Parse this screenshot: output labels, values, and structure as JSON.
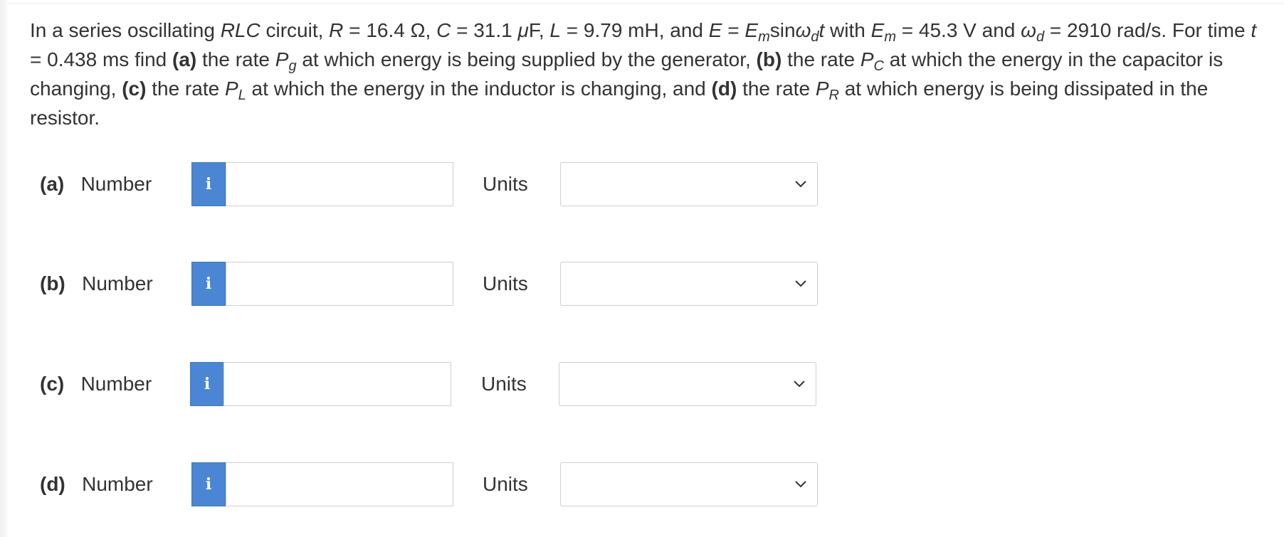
{
  "question": {
    "intro": "In a series oscillating ",
    "rlc": "RLC",
    "circuit": " circuit, ",
    "r_sym": "R",
    "r_val": " = 16.4 Ω, ",
    "c_sym": "C",
    "c_val": " = 31.1 ",
    "mu": "μ",
    "c_unit": "F, ",
    "l_sym": "L",
    "l_val": " = 9.79 mH, and ",
    "e_sym": "E",
    "eq": " = ",
    "em_E": "E",
    "em_sub": "m",
    "sin": "sin",
    "omega": "ω",
    "d_sub": "d",
    "t_sym": "t",
    "with": " with ",
    "em2_E": "E",
    "em2_sub": "m",
    "em_val": " = 45.3 V and ",
    "omega2": "ω",
    "d2_sub": "d",
    "wd_val": " = 2910 rad/s. For time ",
    "t2_sym": "t",
    "t_val": " = 0.438 ms find ",
    "a_tag": "(a)",
    "a_text": " the rate ",
    "pg_P": "P",
    "pg_sub": "g",
    "a_rest": " at which energy is being supplied by the generator, ",
    "b_tag": "(b)",
    "b_text": " the rate ",
    "pc_P": "P",
    "pc_sub": "C",
    "b_rest": " at which the energy in the capacitor is changing, ",
    "c_tag": "(c)",
    "c_text": " the rate ",
    "pl_P": "P",
    "pl_sub": "L",
    "c_rest": " at which the energy in the inductor is changing, and ",
    "d_tag": "(d)",
    "d_text": " the rate ",
    "pr_P": "P",
    "pr_sub": "R",
    "d_rest": " at which energy is being dissipated in the resistor."
  },
  "parts": [
    {
      "tag": "(a)",
      "label": "Number",
      "info_glyph": "i",
      "value": "",
      "units_label": "Units",
      "units_value": ""
    },
    {
      "tag": "(b)",
      "label": "Number",
      "info_glyph": "i",
      "value": "",
      "units_label": "Units",
      "units_value": ""
    },
    {
      "tag": "(c)",
      "label": "Number",
      "info_glyph": "i",
      "value": "",
      "units_label": "Units",
      "units_value": ""
    },
    {
      "tag": "(d)",
      "label": "Number",
      "info_glyph": "i",
      "value": "",
      "units_label": "Units",
      "units_value": ""
    }
  ],
  "colors": {
    "info_button": "#4a86d4",
    "text": "#333333",
    "border": "#cfcfcf"
  },
  "icons": {
    "info": "info-icon",
    "dropdown": "chevron-down-icon"
  }
}
